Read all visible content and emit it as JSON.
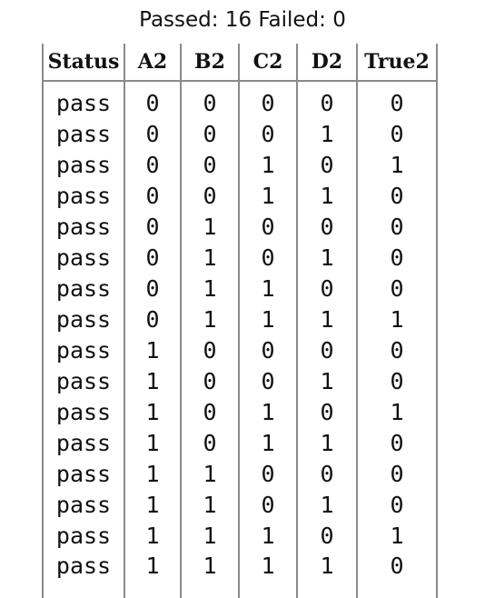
{
  "summary": "Passed: 16 Failed: 0",
  "table": {
    "headers": [
      "Status",
      "A2",
      "B2",
      "C2",
      "D2",
      "True2"
    ],
    "rows": [
      [
        "pass",
        "0",
        "0",
        "0",
        "0",
        "0"
      ],
      [
        "pass",
        "0",
        "0",
        "0",
        "1",
        "0"
      ],
      [
        "pass",
        "0",
        "0",
        "1",
        "0",
        "1"
      ],
      [
        "pass",
        "0",
        "0",
        "1",
        "1",
        "0"
      ],
      [
        "pass",
        "0",
        "1",
        "0",
        "0",
        "0"
      ],
      [
        "pass",
        "0",
        "1",
        "0",
        "1",
        "0"
      ],
      [
        "pass",
        "0",
        "1",
        "1",
        "0",
        "0"
      ],
      [
        "pass",
        "0",
        "1",
        "1",
        "1",
        "1"
      ],
      [
        "pass",
        "1",
        "0",
        "0",
        "0",
        "0"
      ],
      [
        "pass",
        "1",
        "0",
        "0",
        "1",
        "0"
      ],
      [
        "pass",
        "1",
        "0",
        "1",
        "0",
        "1"
      ],
      [
        "pass",
        "1",
        "0",
        "1",
        "1",
        "0"
      ],
      [
        "pass",
        "1",
        "1",
        "0",
        "0",
        "0"
      ],
      [
        "pass",
        "1",
        "1",
        "0",
        "1",
        "0"
      ],
      [
        "pass",
        "1",
        "1",
        "1",
        "0",
        "1"
      ],
      [
        "pass",
        "1",
        "1",
        "1",
        "1",
        "0"
      ]
    ]
  }
}
